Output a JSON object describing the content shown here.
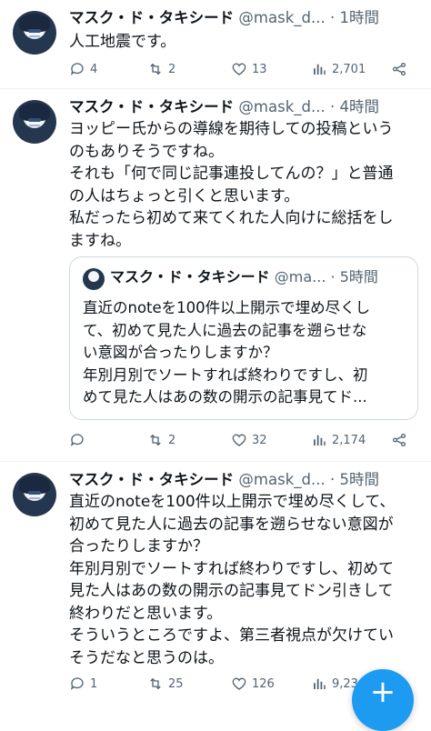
{
  "tweets": [
    {
      "author": "マスク・ド・タキシード",
      "handle": "@mask_d...",
      "time": "· 1時間",
      "lines": [
        "人工地震です。"
      ],
      "replies": "4",
      "retweets": "2",
      "likes": "13",
      "views": "2,701"
    },
    {
      "author": "マスク・ド・タキシード",
      "handle": "@mask_d...",
      "time": "· 4時間",
      "lines": [
        "ヨッピー氏からの導線を期待しての投稿という",
        "のもありそうですね。",
        "それも「何で同じ記事連投してんの？」と普通",
        "の人はちょっと引くと思います。",
        "私だったら初めて来てくれた人向けに総括をし",
        "ますね。"
      ],
      "quote": {
        "author": "マスク・ド・タキシード",
        "handle": "@ma...",
        "time": "· 5時間",
        "lines": [
          "直近のnoteを100件以上開示で埋め尽くし",
          "て、初めて見た人に過去の記事を遡らせな",
          "い意図が合ったりしますか？",
          "年別月別でソートすれば終わりですし、初",
          "めて見た人はあの数の開示の記事見てド..."
        ]
      },
      "replies": "",
      "retweets": "2",
      "likes": "32",
      "views": "2,174"
    },
    {
      "author": "マスク・ド・タキシード",
      "handle": "@mask_d...",
      "time": "· 5時間",
      "lines": [
        "直近のnoteを100件以上開示で埋め尽くして、",
        "初めて見た人に過去の記事を遡らせない意図が",
        "合ったりしますか？",
        "年別月別でソートすれば終わりですし、初めて",
        "見た人はあの数の開示の記事見てドン引きして",
        "終わりだと思います。",
        "そういうところですよ、第三者視点が欠けてい",
        "そうだなと思うのは。"
      ],
      "replies": "1",
      "retweets": "25",
      "likes": "126",
      "views": "9,23"
    }
  ],
  "icons": {
    "reply": "reply-icon",
    "retweet": "retweet-icon",
    "like": "heart-icon",
    "views": "views-icon",
    "share": "share-icon",
    "compose": "compose-plus-icon"
  },
  "fab_label": "+",
  "colors": {
    "accent": "#1d9bf0",
    "meta": "#536471",
    "divider": "#eff3f4",
    "text": "#0f1419"
  }
}
